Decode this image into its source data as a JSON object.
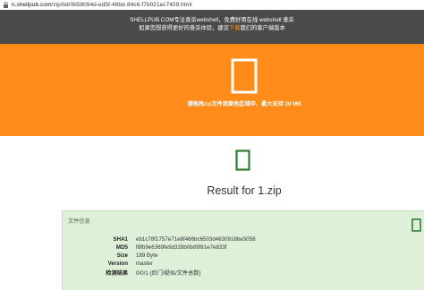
{
  "urlbar": {
    "host": "n.shellpub.com",
    "path": "/zip/tid/0b58094d-ed5f-48bd-84c6-f7b021ec7409.html"
  },
  "banner": {
    "line1": "SHELLPUB.COM专注查杀webshell，免费好用在线 webshell 查杀",
    "line2_before": "如果您想获得更好的查杀体验，建议",
    "line2_link": "下载",
    "line2_after": "我们的客户端版本"
  },
  "dropzone": {
    "hint": "请拖拽zip文件到黄色区域中，最大支持 20 MB"
  },
  "result": {
    "title": "Result for 1.zip"
  },
  "fileinfo": {
    "title": "文件信息",
    "rows": [
      {
        "key": "SHA1",
        "value": "eb1c78f1757e71e8f466bc6503d4630918be5058"
      },
      {
        "key": "MD5",
        "value": "f8fb9e6369fe9d328b0b89f81e7e833f"
      },
      {
        "key": "Size",
        "value": "189 Byte"
      },
      {
        "key": "Version",
        "value": "master"
      },
      {
        "key": "检测结果",
        "value": "0/0/1 (后门/疑似/文件总数)"
      }
    ]
  },
  "colors": {
    "banner_bg": "#4a4a4a",
    "dropzone_bg": "#ff8c1a",
    "panel_bg": "#dff0d8",
    "icon_green": "#2e7d32"
  },
  "icons": {
    "lock": "lock-icon",
    "upload": "file-icon",
    "result": "file-icon",
    "panel": "file-icon"
  }
}
